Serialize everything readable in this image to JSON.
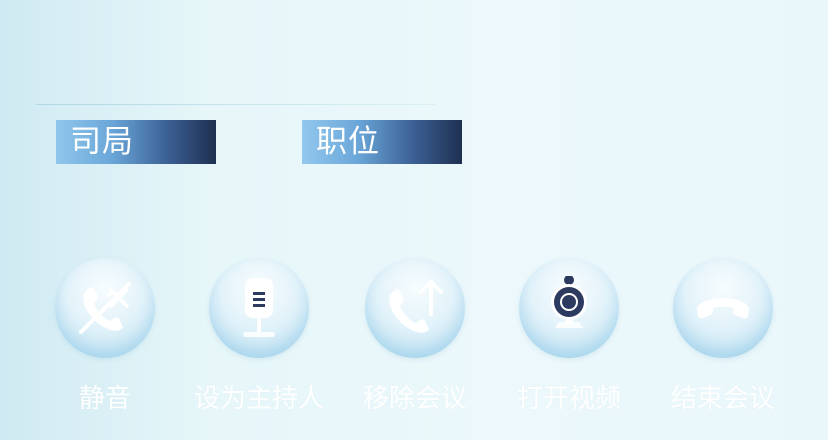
{
  "info": {
    "bureau_tag": "司局",
    "position_tag": "职位"
  },
  "controls": [
    {
      "label": "静音",
      "icon": "phone-mute-icon"
    },
    {
      "label": "设为主持人",
      "icon": "microphone-icon"
    },
    {
      "label": "移除会议",
      "icon": "phone-transfer-icon"
    },
    {
      "label": "打开视频",
      "icon": "webcam-icon"
    },
    {
      "label": "结束会议",
      "icon": "hang-up-icon"
    }
  ],
  "colors": {
    "background": "#e6f6f9",
    "tag_gradient_start": "#8fc6ec",
    "tag_gradient_end": "#1e3050",
    "icon_dark": "#2b3a5e",
    "label_text": "#ffffff"
  }
}
